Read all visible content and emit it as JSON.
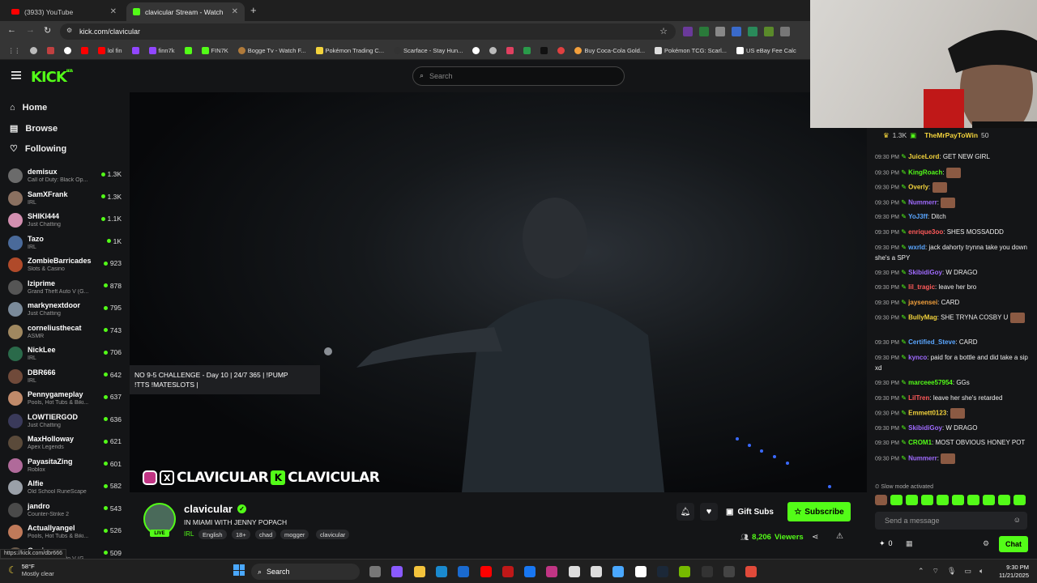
{
  "browser": {
    "tabs": [
      {
        "title": "(3933) YouTube",
        "active": false
      },
      {
        "title": "clavicular Stream - Watch Li",
        "active": true
      }
    ],
    "url": "kick.com/clavicular",
    "bookmarks": [
      "lol fin",
      "finn7k",
      "FIN7K",
      "Bogge Tv - Watch F...",
      "Pokémon Trading C...",
      "Scarface - Stay Hun...",
      "Buy Coca-Cola Gold...",
      "Pokémon TCG: Scarl...",
      "US eBay Fee Calc"
    ],
    "status_url": "https://kick.com/dbr666"
  },
  "header": {
    "logo": "KICK",
    "logo_badge": "BETA",
    "search_placeholder": "Search"
  },
  "sidebar": {
    "nav": [
      {
        "label": "Home",
        "icon": "home-icon"
      },
      {
        "label": "Browse",
        "icon": "browse-icon"
      },
      {
        "label": "Following",
        "icon": "heart-icon"
      }
    ],
    "channels": [
      {
        "name": "demisux",
        "category": "Call of Duty: Black Op...",
        "viewers": "1.3K",
        "color": "#6b6b6b"
      },
      {
        "name": "SamXFrank",
        "category": "IRL",
        "viewers": "1.3K",
        "color": "#8a7060"
      },
      {
        "name": "SHIKI444",
        "category": "Just Chatting",
        "viewers": "1.1K",
        "color": "#d38fb0"
      },
      {
        "name": "Tazo",
        "category": "IRL",
        "viewers": "1K",
        "color": "#4a6a9a"
      },
      {
        "name": "ZombieBarricades",
        "category": "Slots & Casino",
        "viewers": "923",
        "color": "#b04a2a"
      },
      {
        "name": "Iziprime",
        "category": "Grand Theft Auto V (G...",
        "viewers": "878",
        "color": "#555"
      },
      {
        "name": "markynextdoor",
        "category": "Just Chatting",
        "viewers": "795",
        "color": "#7a8a9a"
      },
      {
        "name": "corneliusthecat",
        "category": "ASMR",
        "viewers": "743",
        "color": "#a08860"
      },
      {
        "name": "NickLee",
        "category": "IRL",
        "viewers": "706",
        "color": "#2a6a4a"
      },
      {
        "name": "DBR666",
        "category": "IRL",
        "viewers": "642",
        "color": "#704a3a"
      },
      {
        "name": "Pennygameplay",
        "category": "Pools, Hot Tubs & Biki...",
        "viewers": "637",
        "color": "#c08a6a"
      },
      {
        "name": "LOWTIERGOD",
        "category": "Just Chatting",
        "viewers": "636",
        "color": "#3a3a5a"
      },
      {
        "name": "MaxHolloway",
        "category": "Apex Legends",
        "viewers": "621",
        "color": "#5a4a3a"
      },
      {
        "name": "PayasitaZing",
        "category": "Roblox",
        "viewers": "601",
        "color": "#b06a9a"
      },
      {
        "name": "Alfie",
        "category": "Old School RuneScape",
        "viewers": "582",
        "color": "#9aa0a8"
      },
      {
        "name": "jandro",
        "category": "Counter-Strike 2",
        "viewers": "543",
        "color": "#4a4a4a"
      },
      {
        "name": "Actuallyangel",
        "category": "Pools, Hot Tubs & Biki...",
        "viewers": "526",
        "color": "#c07a5a"
      },
      {
        "name": "Genie",
        "category": "Grand Theft Auto V (G...",
        "viewers": "509",
        "color": "#6a5a4a"
      }
    ]
  },
  "video": {
    "tooltip_line1": "NO 9-5 CHALLENGE - Day 10 | 24/7 365 | !PUMP",
    "tooltip_line2": "!TTS !MATESLOTS |",
    "overlay_text1": "CLAVICULAR",
    "overlay_text2": "CLAVICULAR"
  },
  "stream": {
    "channel": "clavicular",
    "title": "IN MIAMI WITH JENNY POPACH",
    "category": "IRL",
    "tags": [
      "English",
      "18+",
      "chad",
      "mogger",
      "clavicular"
    ],
    "viewers": "8,206",
    "viewers_label": "Viewers",
    "gift_label": "Gift Subs",
    "subscribe_label": "Subscribe",
    "live_badge": "LIVE"
  },
  "chat": {
    "pinned": {
      "count": "1.3K",
      "user": "TheMrPayToWin",
      "amount": "50"
    },
    "messages": [
      {
        "time": "09:30 PM",
        "user": "JuiceLord",
        "color": "#f3d33c",
        "text": "GET NEW GIRL",
        "emote": false
      },
      {
        "time": "09:30 PM",
        "user": "KingRoach",
        "color": "#53fc18",
        "text": "",
        "emote": true
      },
      {
        "time": "09:30 PM",
        "user": "Overly",
        "color": "#f3d33c",
        "text": "",
        "emote": true
      },
      {
        "time": "09:30 PM",
        "user": "Nummerr",
        "color": "#a06bff",
        "text": "",
        "emote": true
      },
      {
        "time": "09:30 PM",
        "user": "YoJ3ff",
        "color": "#5aa6ff",
        "text": "Ditch",
        "emote": false
      },
      {
        "time": "09:30 PM",
        "user": "enrique3oo",
        "color": "#ff5a5a",
        "text": "SHES MOSSADDD",
        "emote": false
      },
      {
        "time": "09:30 PM",
        "user": "wxrld",
        "color": "#5aa6ff",
        "text": "jack dahorty trynna take you down she's a SPY",
        "emote": false
      },
      {
        "time": "09:30 PM",
        "user": "SkibidiGoy",
        "color": "#a06bff",
        "text": "W DRAGO",
        "emote": false
      },
      {
        "time": "09:30 PM",
        "user": "lil_tragic",
        "color": "#ff5a5a",
        "text": "leave her bro",
        "emote": false
      },
      {
        "time": "09:30 PM",
        "user": "jaysensei",
        "color": "#f3a03c",
        "text": "CARD",
        "emote": false
      },
      {
        "time": "09:30 PM",
        "user": "BullyMag",
        "color": "#f3d33c",
        "text": "SHE TRYNA COSBY U",
        "emote": true
      },
      {
        "time": "09:30 PM",
        "user": "Certified_Steve",
        "color": "#5aa6ff",
        "text": "CARD",
        "emote": false
      },
      {
        "time": "09:30 PM",
        "user": "kynco",
        "color": "#a06bff",
        "text": "paid for a bottle and did take a sip xd",
        "emote": false
      },
      {
        "time": "09:30 PM",
        "user": "marceee57954",
        "color": "#53fc18",
        "text": "GGs",
        "emote": false
      },
      {
        "time": "09:30 PM",
        "user": "LilTren",
        "color": "#ff5a5a",
        "text": "leave her she's retarded",
        "emote": false
      },
      {
        "time": "09:30 PM",
        "user": "Emmett0123",
        "color": "#f3d33c",
        "text": "",
        "emote": true
      },
      {
        "time": "09:30 PM",
        "user": "SkibidiGoy",
        "color": "#a06bff",
        "text": "W DRAGO",
        "emote": false
      },
      {
        "time": "09:30 PM",
        "user": "CROM1",
        "color": "#53fc18",
        "text": "MOST OBVIOUS HONEY POT",
        "emote": false
      },
      {
        "time": "09:30 PM",
        "user": "Nummerr",
        "color": "#a06bff",
        "text": "",
        "emote": true
      }
    ],
    "slow_mode": "Slow mode activated",
    "input_placeholder": "Send a message",
    "points": "0",
    "chat_button": "Chat"
  },
  "taskbar": {
    "temp": "58°F",
    "weather": "Mostly clear",
    "search": "Search",
    "time": "9:30 PM",
    "date": "11/21/2025"
  }
}
